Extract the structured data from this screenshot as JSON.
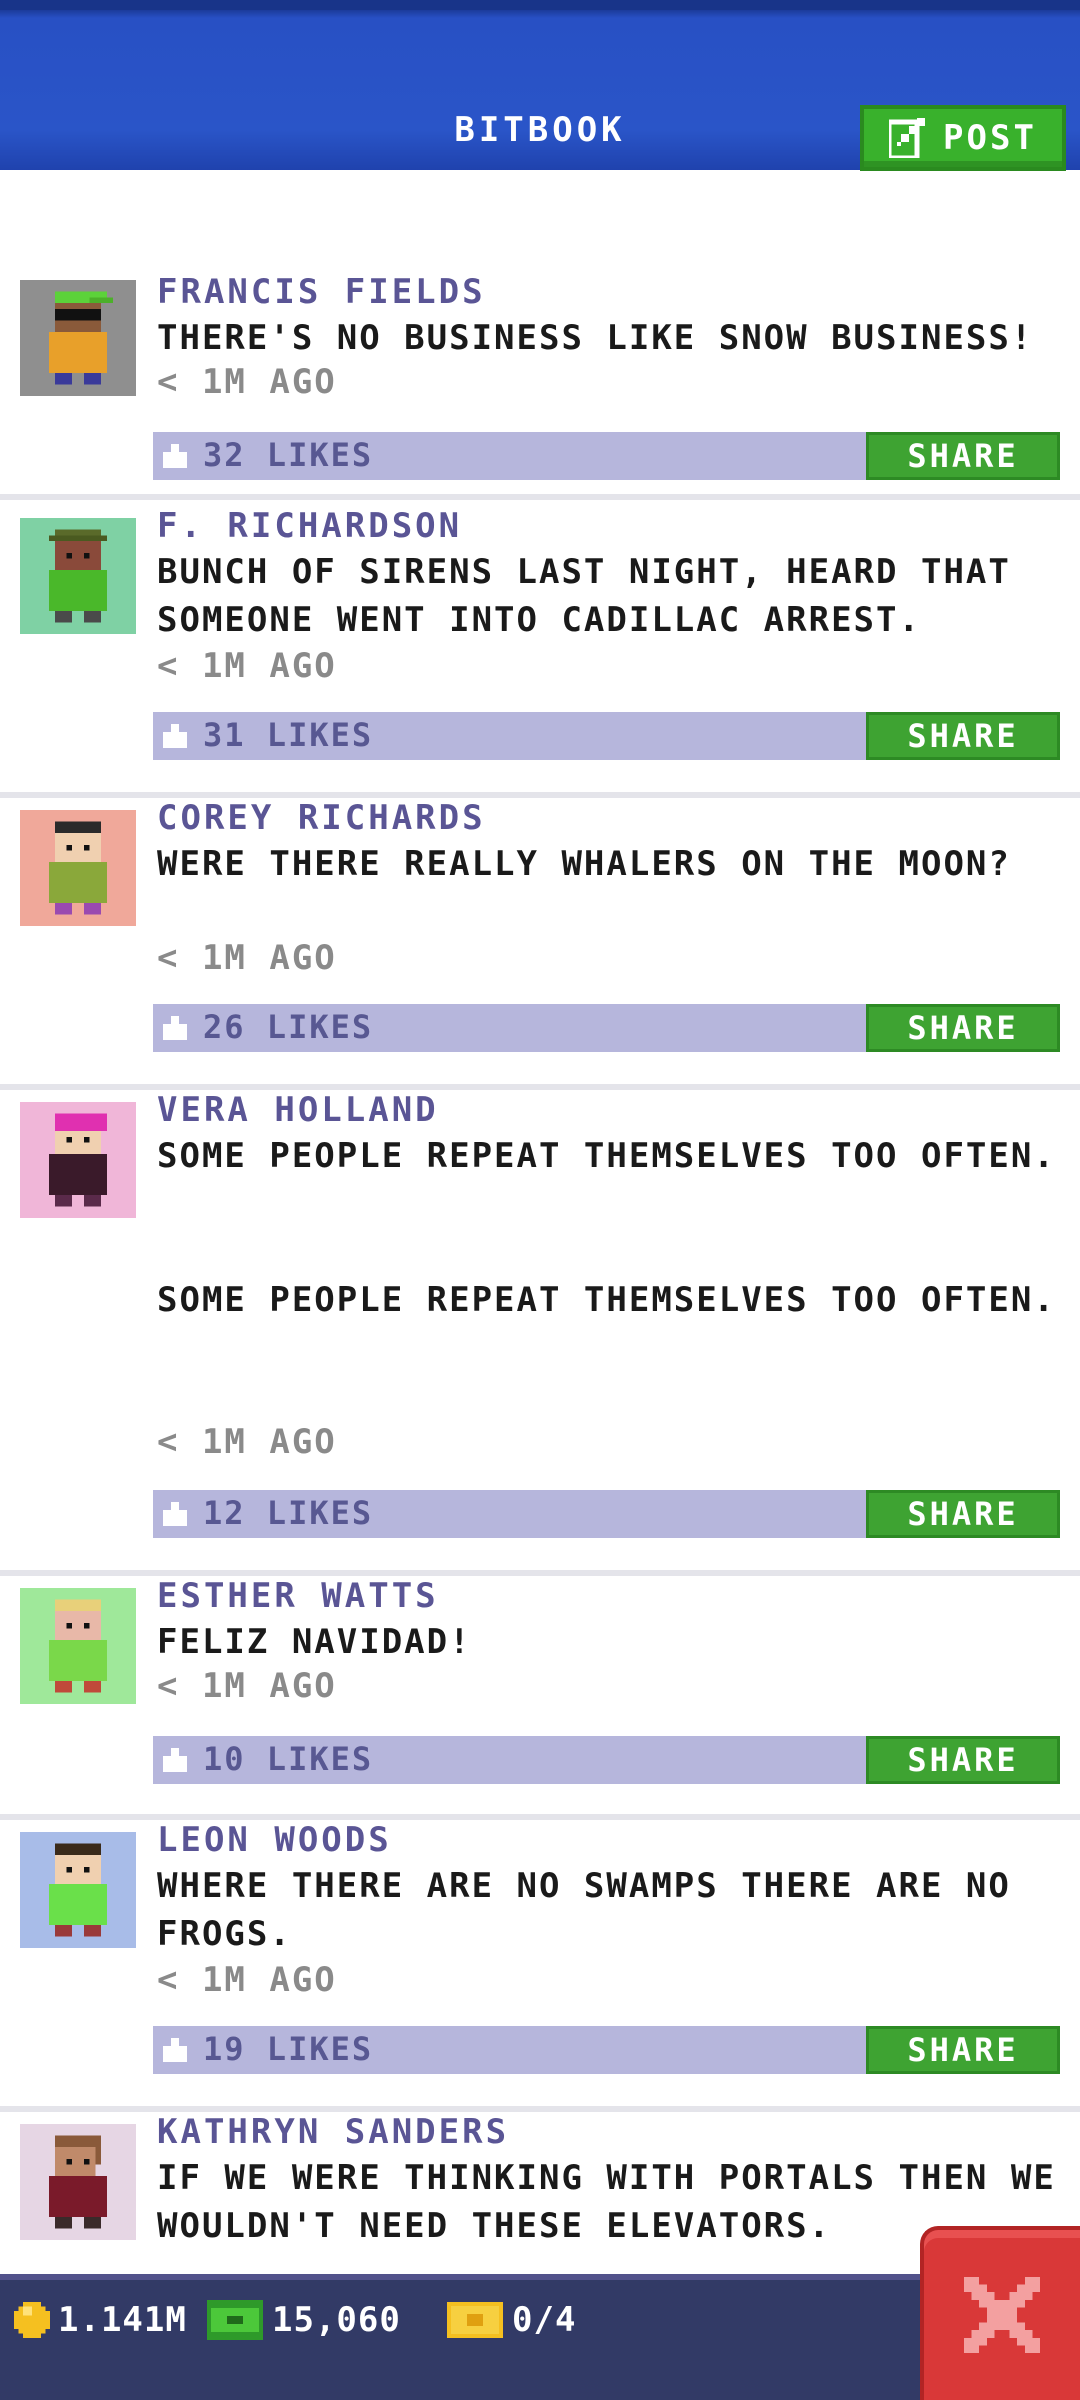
{
  "header": {
    "title": "BITBOOK",
    "post_label": "POST"
  },
  "posts": [
    {
      "author": "FRANCIS FIELDS",
      "message": "THERE'S NO BUSINESS LIKE SNOW BUSINESS!",
      "time": "< 1M AGO",
      "likes": "32 LIKES",
      "share": "SHARE",
      "avatar_bg": "#8f8f8f"
    },
    {
      "author": "F. RICHARDSON",
      "message": "BUNCH OF SIRENS LAST NIGHT, HEARD THAT SOMEONE WENT INTO CADILLAC ARREST.",
      "time": "< 1M AGO",
      "likes": "31 LIKES",
      "share": "SHARE",
      "avatar_bg": "#7fd1a4"
    },
    {
      "author": "COREY RICHARDS",
      "message": "WERE THERE REALLY WHALERS ON THE MOON?",
      "time": "< 1M AGO",
      "likes": "26 LIKES",
      "share": "SHARE",
      "avatar_bg": "#f0a89a"
    },
    {
      "author": "VERA HOLLAND",
      "message": "SOME PEOPLE REPEAT THEMSELVES TOO OFTEN.\n\n\nSOME PEOPLE REPEAT THEMSELVES TOO OFTEN.",
      "time": "< 1M AGO",
      "likes": "12 LIKES",
      "share": "SHARE",
      "avatar_bg": "#f0b6d8"
    },
    {
      "author": "ESTHER WATTS",
      "message": "FELIZ NAVIDAD!",
      "time": "< 1M AGO",
      "likes": "10 LIKES",
      "share": "SHARE",
      "avatar_bg": "#9fe89a"
    },
    {
      "author": "LEON WOODS",
      "message": "WHERE THERE ARE NO SWAMPS THERE ARE NO FROGS.",
      "time": "< 1M AGO",
      "likes": "19 LIKES",
      "share": "SHARE",
      "avatar_bg": "#a8bce8"
    },
    {
      "author": "KATHRYN SANDERS",
      "message": "IF WE WERE THINKING WITH PORTALS THEN WE WOULDN'T NEED THESE ELEVATORS.",
      "time": "",
      "likes": "",
      "share": "",
      "avatar_bg": "#e6d6e4"
    }
  ],
  "footer": {
    "coins": "1.141M",
    "bux": "15,060",
    "tickets": "0/4",
    "close_icon": "close-icon"
  },
  "colors": {
    "header": "#2a55c8",
    "author": "#5a5595",
    "likes_bar": "#b6b6dc",
    "share": "#3ea332",
    "footer": "#323a66",
    "close": "#d93838"
  }
}
